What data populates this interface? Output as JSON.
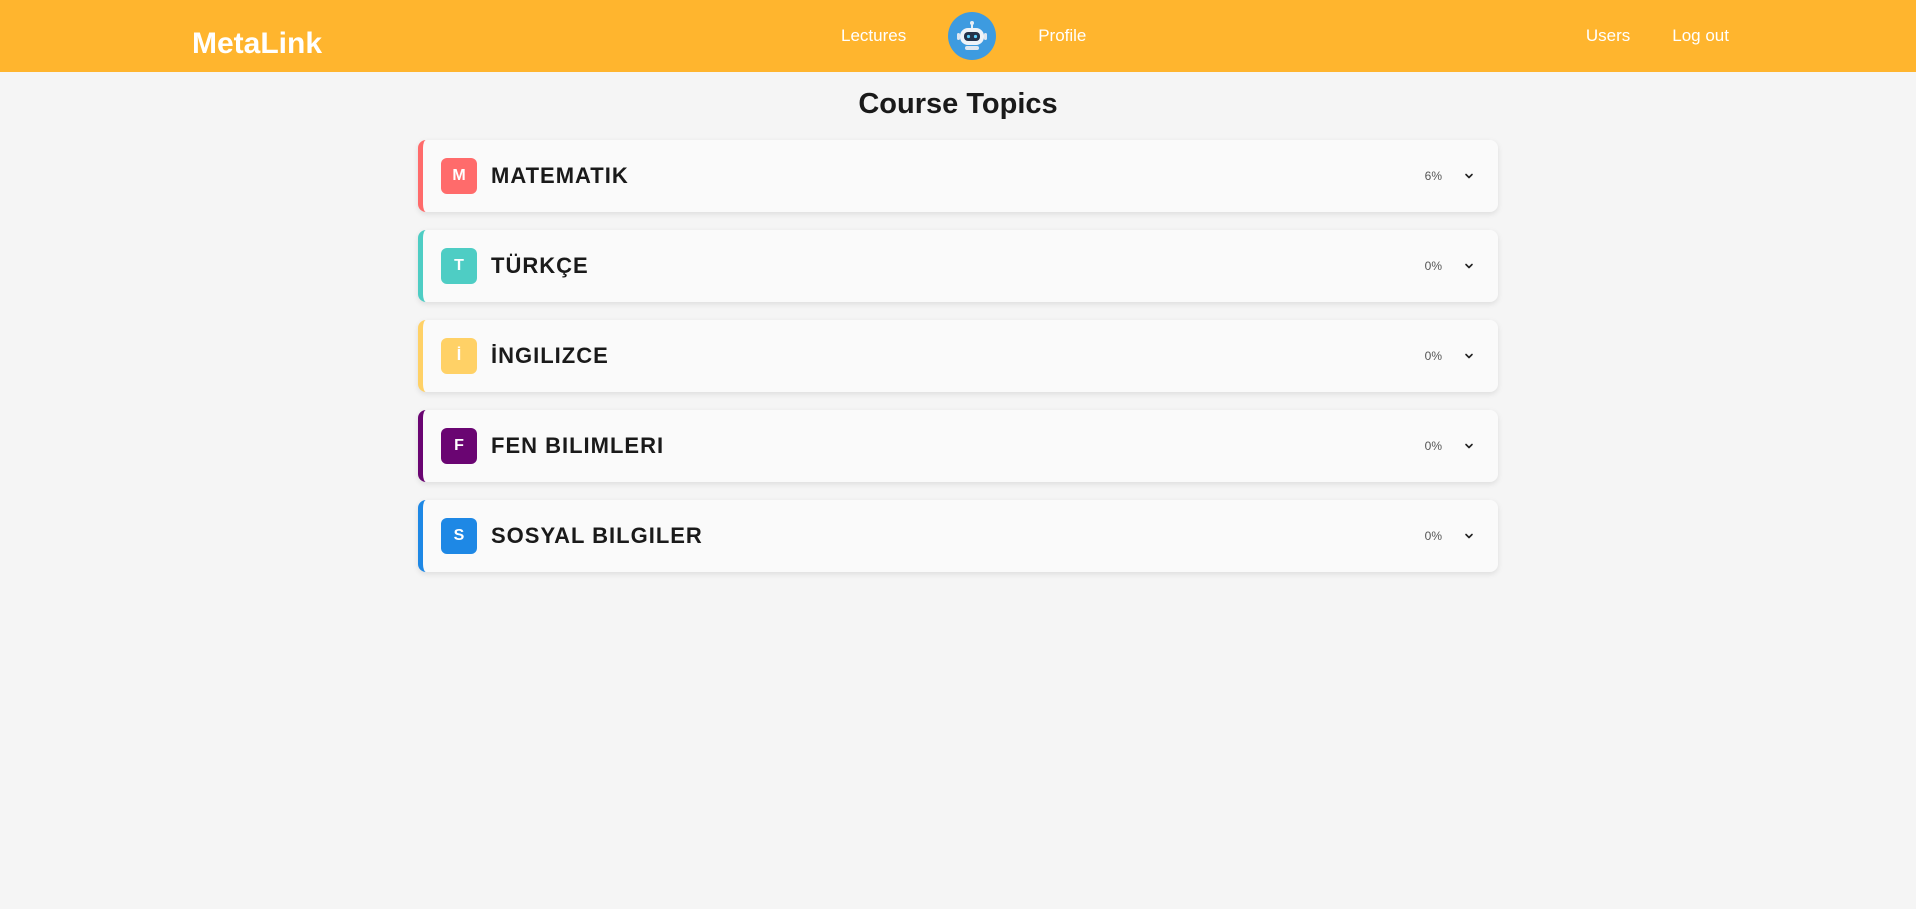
{
  "navbar": {
    "brand": "MetaLink",
    "lectures": "Lectures",
    "profile": "Profile",
    "users": "Users",
    "logout": "Log out"
  },
  "page": {
    "title": "Course Topics"
  },
  "topics": [
    {
      "letter": "M",
      "name": "MATEMATIK",
      "progress": "6%",
      "color": "#ff6b6b"
    },
    {
      "letter": "T",
      "name": "TÜRKÇE",
      "progress": "0%",
      "color": "#4ecdc4"
    },
    {
      "letter": "İ",
      "name": "İNGILIZCE",
      "progress": "0%",
      "color": "#ffd166"
    },
    {
      "letter": "F",
      "name": "FEN BILIMLERI",
      "progress": "0%",
      "color": "#6a0572"
    },
    {
      "letter": "S",
      "name": "SOSYAL BILGILER",
      "progress": "0%",
      "color": "#1e88e5"
    }
  ],
  "colors": {
    "navbar": "#ffb52e",
    "background": "#f5f5f5",
    "bot": "#3d9be0"
  }
}
